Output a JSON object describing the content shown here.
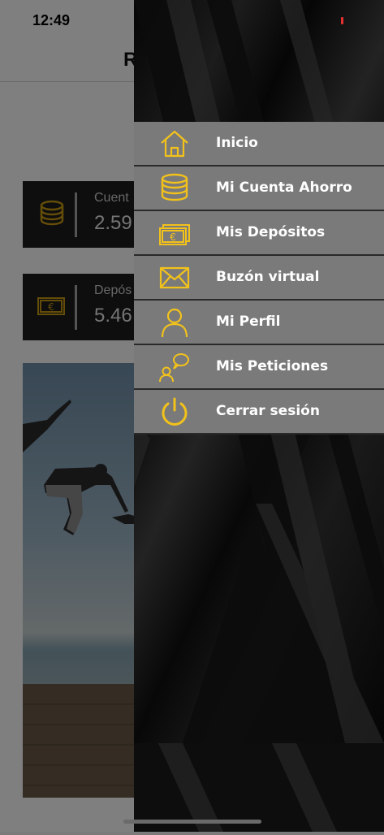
{
  "status_bar": {
    "time": "12:49"
  },
  "header": {
    "title_visible": "R"
  },
  "cards": [
    {
      "label": "Cuent",
      "value": "2.59",
      "icon": "coins-icon"
    },
    {
      "label": "Depós",
      "value": "5.46",
      "icon": "banknote-euro-icon"
    }
  ],
  "drawer": {
    "menu": [
      {
        "label": "Inicio",
        "icon": "home-icon"
      },
      {
        "label": "Mi Cuenta Ahorro",
        "icon": "coins-icon"
      },
      {
        "label": "Mis Depósitos",
        "icon": "banknotes-euro-icon"
      },
      {
        "label": "Buzón virtual",
        "icon": "envelope-icon"
      },
      {
        "label": "Mi Perfil",
        "icon": "user-icon"
      },
      {
        "label": "Mis Peticiones",
        "icon": "chat-users-icon"
      },
      {
        "label": "Cerrar sesión",
        "icon": "power-icon"
      }
    ]
  },
  "colors": {
    "accent": "#f2c21b",
    "menu_bg": "#7a7a7a",
    "card_bg": "#1c1c1c"
  }
}
